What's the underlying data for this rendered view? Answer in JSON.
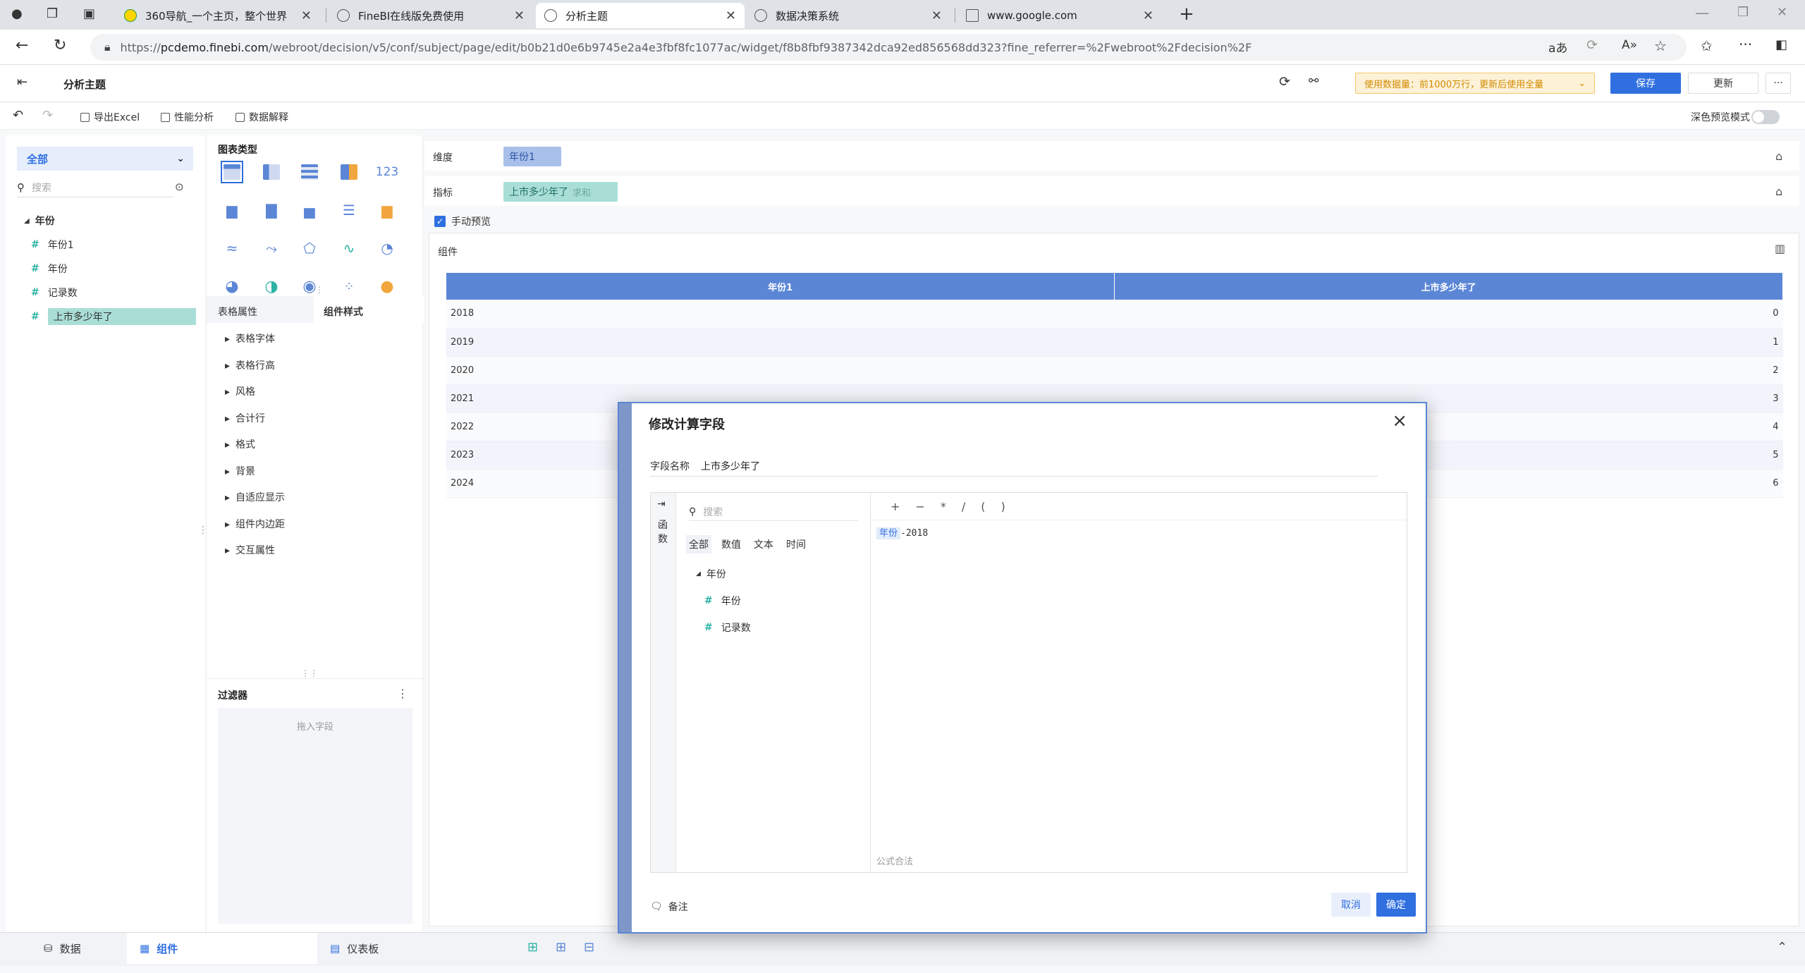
{
  "browser": {
    "tabs": [
      {
        "title": "360导航_一个主页，整个世界",
        "active": false
      },
      {
        "title": "FineBI在线版免费使用",
        "active": false
      },
      {
        "title": "分析主题",
        "active": true
      },
      {
        "title": "数据决策系统",
        "active": false
      },
      {
        "title": "www.google.com",
        "active": false
      }
    ],
    "url_prefix": "https://",
    "url_host": "pcdemo.finebi.com",
    "url_path": "/webroot/decision/v5/conf/subject/page/edit/b0b21d0e6b9745e2a4e3fbf8fc1077ac/widget/f8b8fbf9387342dca92ed856568dd323?fine_referrer=%2Fwebroot%2Fdecision%2F"
  },
  "header": {
    "title": "分析主题",
    "data_notice": "使用数据量：前1000万行，更新后使用全量",
    "save_label": "保存",
    "update_label": "更新",
    "more_label": "···"
  },
  "toolbar": {
    "export_label": "导出Excel",
    "perf_label": "性能分析",
    "explain_label": "数据解释",
    "dark_preview_label": "深色预览模式"
  },
  "left_panel": {
    "scope": "全部",
    "search_placeholder": "搜索",
    "group": "年份",
    "fields": [
      "年份1",
      "年份",
      "记录数",
      "上市多少年了"
    ]
  },
  "mid_panel": {
    "chart_type_title": "图表类型",
    "tab_table_props": "表格属性",
    "tab_component_style": "组件样式",
    "props": [
      "表格字体",
      "表格行高",
      "风格",
      "合计行",
      "格式",
      "背景",
      "自适应显示",
      "组件内边距",
      "交互属性"
    ],
    "filter_title": "过滤器",
    "filter_drop": "拖入字段"
  },
  "work": {
    "dimension_label": "维度",
    "dimension_pill": "年份1",
    "measure_label": "指标",
    "measure_pill": "上市多少年了",
    "measure_agg": "求和",
    "manual_preview": "手动预览",
    "component_label": "组件",
    "table": {
      "headers": [
        "年份1",
        "上市多少年了"
      ],
      "rows": [
        [
          "2018",
          "0"
        ],
        [
          "2019",
          "1"
        ],
        [
          "2020",
          "2"
        ],
        [
          "2021",
          "3"
        ],
        [
          "2022",
          "4"
        ],
        [
          "2023",
          "5"
        ],
        [
          "2024",
          "6"
        ]
      ]
    }
  },
  "bottom": {
    "data_tab": "数据",
    "component_tab": "组件",
    "dashboard_tab": "仪表板"
  },
  "modal": {
    "title": "修改计算字段",
    "field_name_label": "字段名称",
    "field_name_value": "上市多少年了",
    "functions_label": "函数",
    "search_placeholder": "搜索",
    "filters": [
      "全部",
      "数值",
      "文本",
      "时间"
    ],
    "ops": [
      "+",
      "−",
      "*",
      "/",
      "(",
      ")"
    ],
    "tree_group": "年份",
    "tree_fields": [
      "年份",
      "记录数"
    ],
    "formula_token": "年份",
    "formula_rest": "-2018",
    "formula_status": "公式合法",
    "note_label": "备注",
    "cancel_label": "取消",
    "confirm_label": "确定"
  }
}
